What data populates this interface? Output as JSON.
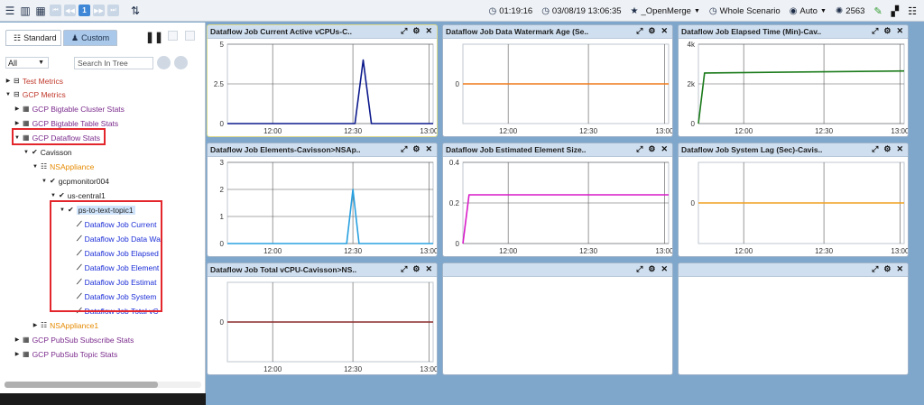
{
  "toolbar": {
    "time": "01:19:16",
    "datetime": "03/08/19 13:06:35",
    "merge": "_OpenMerge",
    "scenario": "Whole Scenario",
    "view": "Auto",
    "count": "2563",
    "page": "1"
  },
  "left": {
    "tab_standard": "Standard",
    "tab_custom": "Custom",
    "filter_value": "All",
    "search_placeholder": "Search In Tree"
  },
  "tree": [
    {
      "label": "Test Metrics",
      "color": "#c0392b"
    },
    {
      "label": "GCP Metrics",
      "color": "#c0392b"
    },
    {
      "label": "GCP Bigtable Cluster Stats",
      "color": "#7a2a8c"
    },
    {
      "label": "GCP Bigtable Table Stats",
      "color": "#7a2a8c"
    },
    {
      "label": "GCP Dataflow Stats",
      "color": "#7a2a8c"
    },
    {
      "label": "Cavisson",
      "color": "#222222"
    },
    {
      "label": "NSAppliance",
      "color": "#e58a00"
    },
    {
      "label": "gcpmonitor004",
      "color": "#222222"
    },
    {
      "label": "us-central1",
      "color": "#222222"
    },
    {
      "label": "ps-to-text-topic1",
      "color": "#222222"
    },
    {
      "label": "Dataflow Job Current",
      "color": "#1c2ed6"
    },
    {
      "label": "Dataflow Job Data Wa",
      "color": "#1c2ed6"
    },
    {
      "label": "Dataflow Job Elapsed",
      "color": "#1c2ed6"
    },
    {
      "label": "Dataflow Job Element",
      "color": "#1c2ed6"
    },
    {
      "label": "Dataflow Job Estimat",
      "color": "#1c2ed6"
    },
    {
      "label": "Dataflow Job System",
      "color": "#1c2ed6"
    },
    {
      "label": "Dataflow Job Total vC",
      "color": "#1c2ed6"
    },
    {
      "label": "NSAppliance1",
      "color": "#e58a00"
    },
    {
      "label": "GCP PubSub Subscribe Stats",
      "color": "#7a2a8c"
    },
    {
      "label": "GCP PubSub Topic Stats",
      "color": "#7a2a8c"
    }
  ],
  "panels": [
    {
      "title": "Dataflow Job Current Active vCPUs-C..",
      "chart": 0
    },
    {
      "title": "Dataflow Job Data Watermark Age (Se..",
      "chart": 1
    },
    {
      "title": "Dataflow Job Elapsed Time (Min)-Cav..",
      "chart": 2
    },
    {
      "title": "Dataflow Job Elements-Cavisson>NSAp..",
      "chart": 3
    },
    {
      "title": "Dataflow Job Estimated Element Size..",
      "chart": 4
    },
    {
      "title": "Dataflow Job System Lag (Sec)-Cavis..",
      "chart": 5
    },
    {
      "title": "Dataflow Job Total vCPU-Cavisson>NS..",
      "chart": 6
    },
    {
      "title": "",
      "chart": null
    },
    {
      "title": "",
      "chart": null
    }
  ],
  "chart_data": [
    {
      "type": "line",
      "color": "#0d1a8c",
      "x": [
        "12:00",
        "12:30",
        "13:00"
      ],
      "yticks": [
        "0",
        "2.5",
        "5"
      ],
      "ylim": [
        0,
        5
      ],
      "series": [
        {
          "points": [
            [
              0,
              0
            ],
            [
              0.62,
              0
            ],
            [
              0.66,
              4
            ],
            [
              0.7,
              0
            ],
            [
              1,
              0
            ]
          ]
        }
      ]
    },
    {
      "type": "line",
      "color": "#f07a1a",
      "x": [
        "12:00",
        "12:30",
        "13:00"
      ],
      "yticks": [
        "0"
      ],
      "ylim": [
        -1,
        1
      ],
      "series": [
        {
          "points": [
            [
              0,
              0
            ],
            [
              1,
              0
            ]
          ]
        }
      ]
    },
    {
      "type": "line",
      "color": "#1a7a1a",
      "x": [
        "12:00",
        "12:30",
        "13:00"
      ],
      "yticks": [
        "0",
        "2k",
        "4k"
      ],
      "ylim": [
        0,
        4000
      ],
      "series": [
        {
          "points": [
            [
              0,
              0
            ],
            [
              0.03,
              2550
            ],
            [
              0.5,
              2600
            ],
            [
              1,
              2650
            ]
          ]
        }
      ]
    },
    {
      "type": "line",
      "color": "#28a0e0",
      "x": [
        "12:00",
        "12:30",
        "13:00"
      ],
      "yticks": [
        "0",
        "1",
        "2",
        "3"
      ],
      "ylim": [
        0,
        3
      ],
      "series": [
        {
          "points": [
            [
              0,
              0
            ],
            [
              0.58,
              0
            ],
            [
              0.61,
              2
            ],
            [
              0.64,
              0
            ],
            [
              1,
              0
            ]
          ]
        }
      ]
    },
    {
      "type": "line",
      "color": "#d81bc8",
      "x": [
        "12:00",
        "12:30",
        "13:00"
      ],
      "yticks": [
        "0",
        "0.2",
        "0.4"
      ],
      "ylim": [
        0,
        0.4
      ],
      "series": [
        {
          "points": [
            [
              0,
              0
            ],
            [
              0.03,
              0.24
            ],
            [
              1,
              0.24
            ]
          ]
        }
      ]
    },
    {
      "type": "line",
      "color": "#f0a020",
      "x": [
        "12:00",
        "12:30",
        "13:00"
      ],
      "yticks": [
        "0"
      ],
      "ylim": [
        -1,
        1
      ],
      "series": [
        {
          "points": [
            [
              0,
              0
            ],
            [
              1,
              0
            ]
          ]
        }
      ]
    },
    {
      "type": "line",
      "color": "#8a2a2a",
      "x": [
        "12:00",
        "12:30",
        "13:00"
      ],
      "yticks": [
        "0"
      ],
      "ylim": [
        -1,
        1
      ],
      "series": [
        {
          "points": [
            [
              0,
              0
            ],
            [
              1,
              0
            ]
          ]
        }
      ]
    }
  ]
}
